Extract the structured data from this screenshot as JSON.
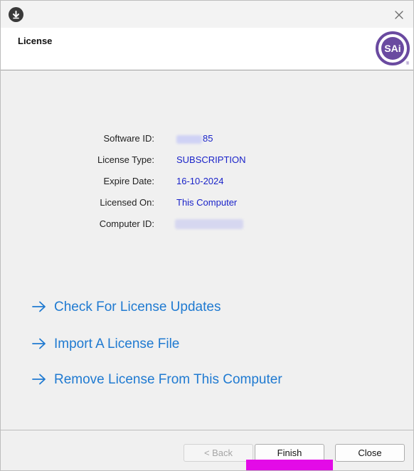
{
  "window": {
    "app_icon": "download-arrow-icon",
    "close_icon": "close-icon"
  },
  "header": {
    "title": "License",
    "logo_text": "SAi",
    "logo_mark": "®",
    "logo_color": "#6a4aa0"
  },
  "info": [
    {
      "label": "Software ID:",
      "value": "85"
    },
    {
      "label": "License Type:",
      "value": "SUBSCRIPTION"
    },
    {
      "label": "Expire Date:",
      "value": "16-10-2024"
    },
    {
      "label": "Licensed On:",
      "value": "This Computer"
    },
    {
      "label": "Computer ID:",
      "value": ""
    }
  ],
  "links": [
    {
      "label": "Check For License Updates",
      "icon": "arrow-right-icon"
    },
    {
      "label": "Import A License File",
      "icon": "arrow-right-icon"
    },
    {
      "label": "Remove License From This Computer",
      "icon": "arrow-right-icon"
    }
  ],
  "footer": {
    "back_label": "< Back",
    "finish_label": "Finish",
    "close_label": "Close"
  },
  "colors": {
    "link": "#1f7ad1",
    "value": "#1a23c9",
    "highlight": "#e30be7"
  }
}
